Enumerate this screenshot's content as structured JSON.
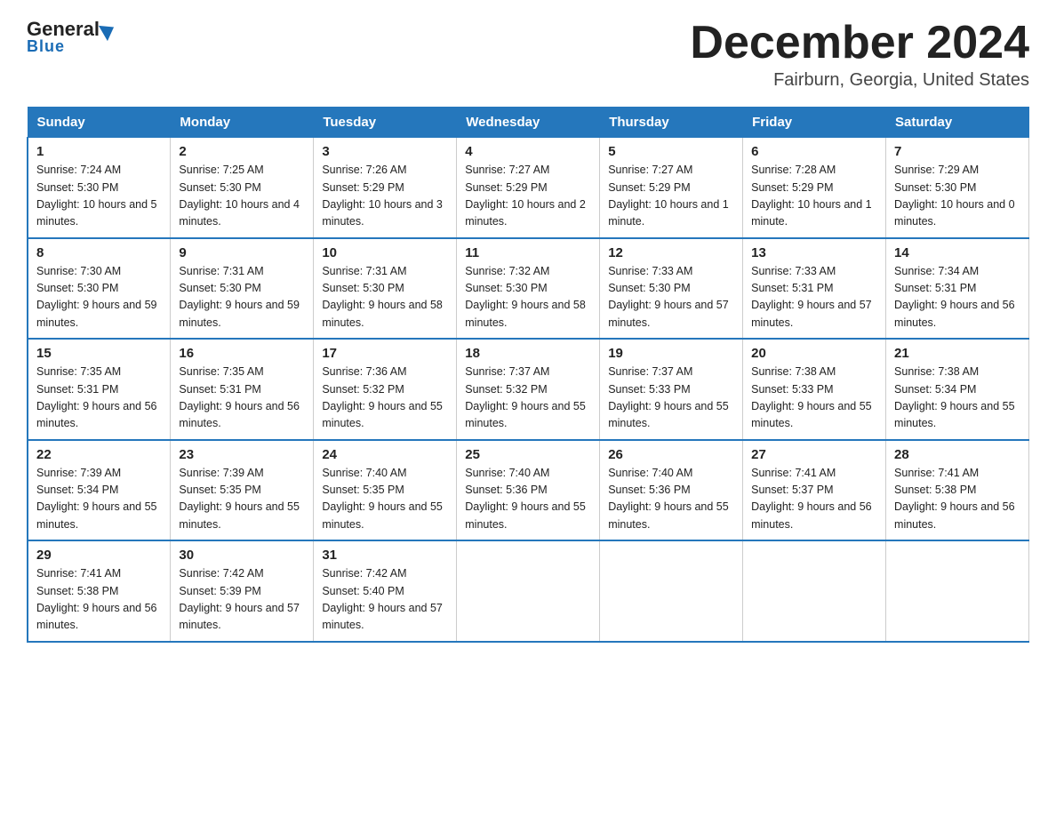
{
  "header": {
    "logo_general": "General",
    "logo_blue": "Blue",
    "month_title": "December 2024",
    "location": "Fairburn, Georgia, United States"
  },
  "days_of_week": [
    "Sunday",
    "Monday",
    "Tuesday",
    "Wednesday",
    "Thursday",
    "Friday",
    "Saturday"
  ],
  "weeks": [
    [
      {
        "day": "1",
        "sunrise": "7:24 AM",
        "sunset": "5:30 PM",
        "daylight": "10 hours and 5 minutes."
      },
      {
        "day": "2",
        "sunrise": "7:25 AM",
        "sunset": "5:30 PM",
        "daylight": "10 hours and 4 minutes."
      },
      {
        "day": "3",
        "sunrise": "7:26 AM",
        "sunset": "5:29 PM",
        "daylight": "10 hours and 3 minutes."
      },
      {
        "day": "4",
        "sunrise": "7:27 AM",
        "sunset": "5:29 PM",
        "daylight": "10 hours and 2 minutes."
      },
      {
        "day": "5",
        "sunrise": "7:27 AM",
        "sunset": "5:29 PM",
        "daylight": "10 hours and 1 minute."
      },
      {
        "day": "6",
        "sunrise": "7:28 AM",
        "sunset": "5:29 PM",
        "daylight": "10 hours and 1 minute."
      },
      {
        "day": "7",
        "sunrise": "7:29 AM",
        "sunset": "5:30 PM",
        "daylight": "10 hours and 0 minutes."
      }
    ],
    [
      {
        "day": "8",
        "sunrise": "7:30 AM",
        "sunset": "5:30 PM",
        "daylight": "9 hours and 59 minutes."
      },
      {
        "day": "9",
        "sunrise": "7:31 AM",
        "sunset": "5:30 PM",
        "daylight": "9 hours and 59 minutes."
      },
      {
        "day": "10",
        "sunrise": "7:31 AM",
        "sunset": "5:30 PM",
        "daylight": "9 hours and 58 minutes."
      },
      {
        "day": "11",
        "sunrise": "7:32 AM",
        "sunset": "5:30 PM",
        "daylight": "9 hours and 58 minutes."
      },
      {
        "day": "12",
        "sunrise": "7:33 AM",
        "sunset": "5:30 PM",
        "daylight": "9 hours and 57 minutes."
      },
      {
        "day": "13",
        "sunrise": "7:33 AM",
        "sunset": "5:31 PM",
        "daylight": "9 hours and 57 minutes."
      },
      {
        "day": "14",
        "sunrise": "7:34 AM",
        "sunset": "5:31 PM",
        "daylight": "9 hours and 56 minutes."
      }
    ],
    [
      {
        "day": "15",
        "sunrise": "7:35 AM",
        "sunset": "5:31 PM",
        "daylight": "9 hours and 56 minutes."
      },
      {
        "day": "16",
        "sunrise": "7:35 AM",
        "sunset": "5:31 PM",
        "daylight": "9 hours and 56 minutes."
      },
      {
        "day": "17",
        "sunrise": "7:36 AM",
        "sunset": "5:32 PM",
        "daylight": "9 hours and 55 minutes."
      },
      {
        "day": "18",
        "sunrise": "7:37 AM",
        "sunset": "5:32 PM",
        "daylight": "9 hours and 55 minutes."
      },
      {
        "day": "19",
        "sunrise": "7:37 AM",
        "sunset": "5:33 PM",
        "daylight": "9 hours and 55 minutes."
      },
      {
        "day": "20",
        "sunrise": "7:38 AM",
        "sunset": "5:33 PM",
        "daylight": "9 hours and 55 minutes."
      },
      {
        "day": "21",
        "sunrise": "7:38 AM",
        "sunset": "5:34 PM",
        "daylight": "9 hours and 55 minutes."
      }
    ],
    [
      {
        "day": "22",
        "sunrise": "7:39 AM",
        "sunset": "5:34 PM",
        "daylight": "9 hours and 55 minutes."
      },
      {
        "day": "23",
        "sunrise": "7:39 AM",
        "sunset": "5:35 PM",
        "daylight": "9 hours and 55 minutes."
      },
      {
        "day": "24",
        "sunrise": "7:40 AM",
        "sunset": "5:35 PM",
        "daylight": "9 hours and 55 minutes."
      },
      {
        "day": "25",
        "sunrise": "7:40 AM",
        "sunset": "5:36 PM",
        "daylight": "9 hours and 55 minutes."
      },
      {
        "day": "26",
        "sunrise": "7:40 AM",
        "sunset": "5:36 PM",
        "daylight": "9 hours and 55 minutes."
      },
      {
        "day": "27",
        "sunrise": "7:41 AM",
        "sunset": "5:37 PM",
        "daylight": "9 hours and 56 minutes."
      },
      {
        "day": "28",
        "sunrise": "7:41 AM",
        "sunset": "5:38 PM",
        "daylight": "9 hours and 56 minutes."
      }
    ],
    [
      {
        "day": "29",
        "sunrise": "7:41 AM",
        "sunset": "5:38 PM",
        "daylight": "9 hours and 56 minutes."
      },
      {
        "day": "30",
        "sunrise": "7:42 AM",
        "sunset": "5:39 PM",
        "daylight": "9 hours and 57 minutes."
      },
      {
        "day": "31",
        "sunrise": "7:42 AM",
        "sunset": "5:40 PM",
        "daylight": "9 hours and 57 minutes."
      },
      null,
      null,
      null,
      null
    ]
  ]
}
